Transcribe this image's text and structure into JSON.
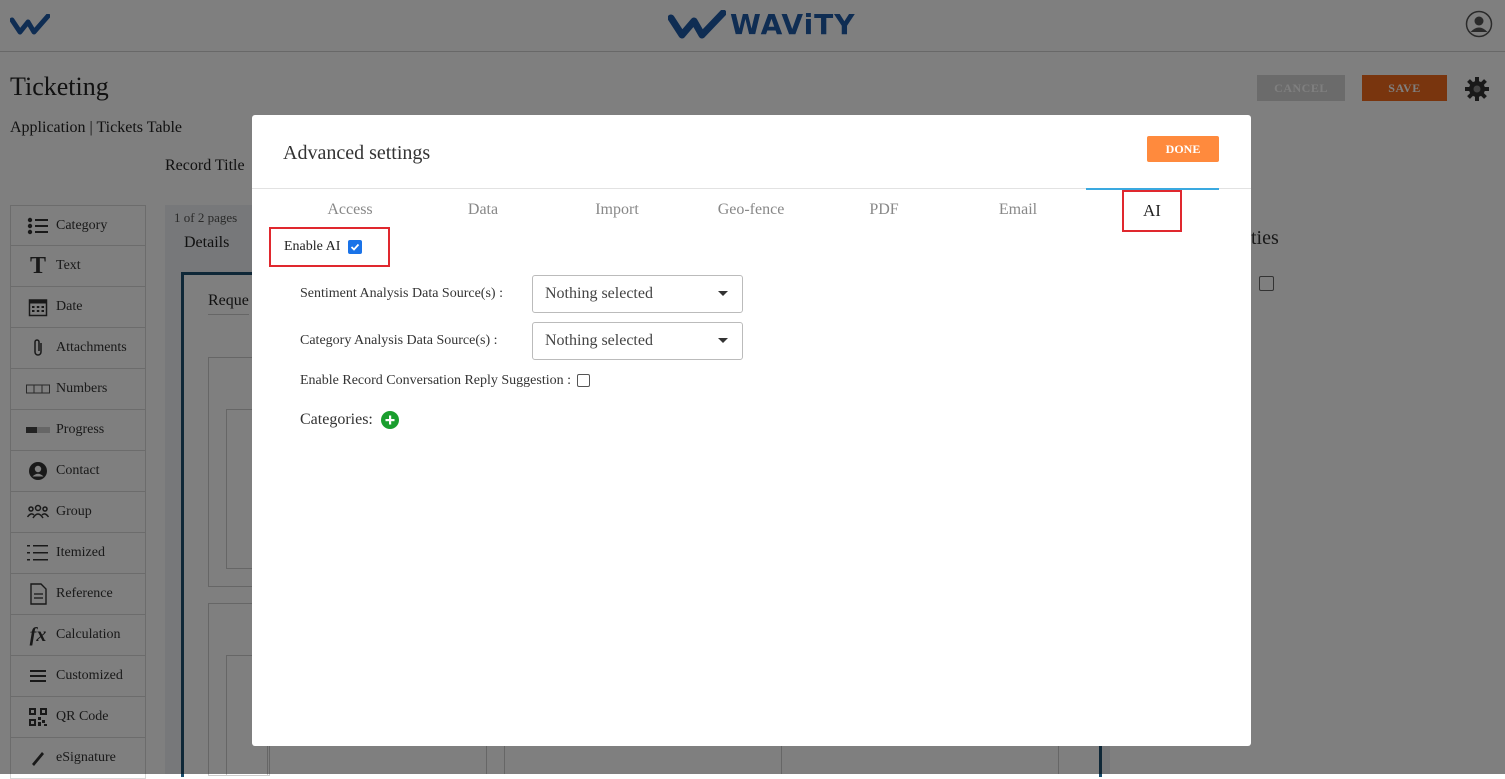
{
  "header": {
    "brand": "WAViTY"
  },
  "page": {
    "title": "Ticketing",
    "breadcrumb": "Application | Tickets Table",
    "record_title_label": "Record Title",
    "cancel_label": "CANCEL",
    "save_label": "SAVE"
  },
  "palette": {
    "items": [
      {
        "label": "Category",
        "icon": "list-icon"
      },
      {
        "label": "Text",
        "icon": "text-icon"
      },
      {
        "label": "Date",
        "icon": "calendar-icon"
      },
      {
        "label": "Attachments",
        "icon": "paperclip-icon"
      },
      {
        "label": "Numbers",
        "icon": "numbers-icon"
      },
      {
        "label": "Progress",
        "icon": "progress-icon"
      },
      {
        "label": "Contact",
        "icon": "contact-icon"
      },
      {
        "label": "Group",
        "icon": "group-icon"
      },
      {
        "label": "Itemized",
        "icon": "itemized-icon"
      },
      {
        "label": "Reference",
        "icon": "document-icon"
      },
      {
        "label": "Calculation",
        "icon": "fx-icon"
      },
      {
        "label": "Customized",
        "icon": "menu-icon"
      },
      {
        "label": "QR Code",
        "icon": "qr-icon"
      },
      {
        "label": "eSignature",
        "icon": "pen-icon"
      }
    ]
  },
  "canvas": {
    "pages_label": "1 of 2 pages",
    "details_label": "Details",
    "section_label": "Reque",
    "props_label": "ties"
  },
  "modal": {
    "title": "Advanced settings",
    "done_label": "DONE",
    "tabs": [
      "Access",
      "Data",
      "Import",
      "Geo-fence",
      "PDF",
      "Email",
      "AI"
    ],
    "active_tab": "AI",
    "enable_ai_label": "Enable AI",
    "enable_ai_checked": true,
    "sentiment_label": "Sentiment Analysis Data Source(s) :",
    "sentiment_value": "Nothing selected",
    "category_label": "Category Analysis Data Source(s) :",
    "category_value": "Nothing selected",
    "reply_suggestion_label": "Enable Record Conversation Reply Suggestion :",
    "reply_suggestion_checked": false,
    "categories_label": "Categories:"
  },
  "colors": {
    "accent_orange": "#ff8a3d",
    "save_orange": "#f26b1d",
    "highlight_red": "#e0282e",
    "tab_blue": "#3aa9e0",
    "brand_blue": "#1f5aa6",
    "add_green": "#1a9e2e"
  }
}
